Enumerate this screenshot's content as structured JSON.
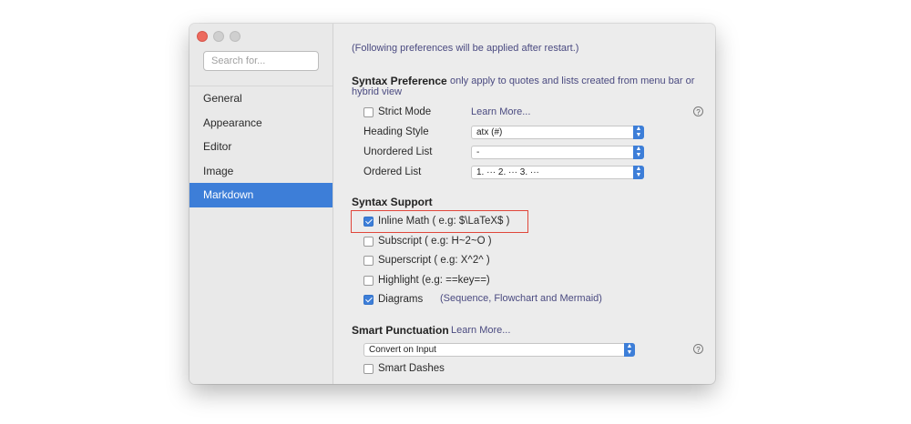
{
  "sidebar": {
    "search_placeholder": "Search for...",
    "items": [
      {
        "label": "General"
      },
      {
        "label": "Appearance"
      },
      {
        "label": "Editor"
      },
      {
        "label": "Image"
      },
      {
        "label": "Markdown",
        "active": true
      }
    ]
  },
  "main": {
    "restart_note": "(Following preferences will be applied after restart.)",
    "syntax_preference": {
      "title": "Syntax Preference",
      "note_line1": "only apply to quotes and lists created from menu bar or",
      "note_line2": "hybrid view",
      "strict_mode": {
        "label": "Strict Mode",
        "checked": false
      },
      "learn_more": "Learn More...",
      "heading_style": {
        "label": "Heading Style",
        "value": "atx (#)"
      },
      "unordered_list": {
        "label": "Unordered List",
        "value": "-"
      },
      "ordered_list": {
        "label": "Ordered List",
        "value": "1. ··· 2. ··· 3. ···"
      }
    },
    "syntax_support": {
      "title": "Syntax Support",
      "options": [
        {
          "label": "Inline Math ( e.g: $\\LaTeX$ )",
          "checked": true
        },
        {
          "label": "Subscript ( e.g: H~2~O )",
          "checked": false
        },
        {
          "label": "Superscript ( e.g: X^2^ )",
          "checked": false
        },
        {
          "label": "Highlight (e.g: ==key==)",
          "checked": false
        },
        {
          "label": "Diagrams",
          "checked": true
        }
      ],
      "diagrams_note": "(Sequence, Flowchart and Mermaid)"
    },
    "smart_punctuation": {
      "title": "Smart Punctuation",
      "learn_more": "Learn More...",
      "mode": "Convert on Input",
      "smart_dashes": {
        "label": "Smart Dashes",
        "checked": false
      }
    }
  },
  "colors": {
    "accent": "#3d7ed8",
    "highlight_box": "#e0463a",
    "close_button": "#ed6a5e"
  }
}
